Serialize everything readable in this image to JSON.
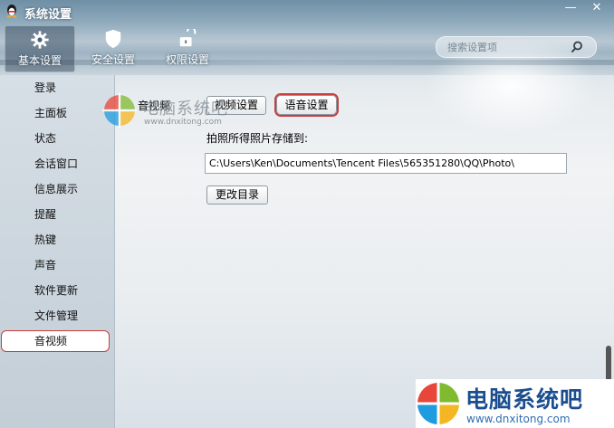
{
  "window": {
    "title": "系统设置",
    "minimize": "—",
    "close": "✕"
  },
  "top_tabs": [
    {
      "label": "基本设置",
      "icon": "gear-icon",
      "active": true
    },
    {
      "label": "安全设置",
      "icon": "shield-icon",
      "active": false
    },
    {
      "label": "权限设置",
      "icon": "unlock-icon",
      "active": false
    }
  ],
  "search": {
    "placeholder": "搜索设置项",
    "icon": "search-icon"
  },
  "sidebar": {
    "items": [
      {
        "label": "登录"
      },
      {
        "label": "主面板"
      },
      {
        "label": "状态"
      },
      {
        "label": "会话窗口"
      },
      {
        "label": "信息展示"
      },
      {
        "label": "提醒"
      },
      {
        "label": "热键"
      },
      {
        "label": "声音"
      },
      {
        "label": "软件更新"
      },
      {
        "label": "文件管理"
      },
      {
        "label": "音视频",
        "selected": true
      }
    ]
  },
  "content": {
    "section_title": "音视频",
    "video_button": "视频设置",
    "voice_button": "语音设置",
    "photo_path_label": "拍照所得照片存储到:",
    "photo_path_value": "C:\\Users\\Ken\\Documents\\Tencent Files\\565351280\\QQ\\Photo\\",
    "change_dir_button": "更改目录"
  },
  "watermark": {
    "name": "电脑系统吧",
    "url": "www.dnxitong.com"
  },
  "colors": {
    "highlight_red": "#cc3b3b",
    "brand_blue": "#1b4e8f"
  }
}
